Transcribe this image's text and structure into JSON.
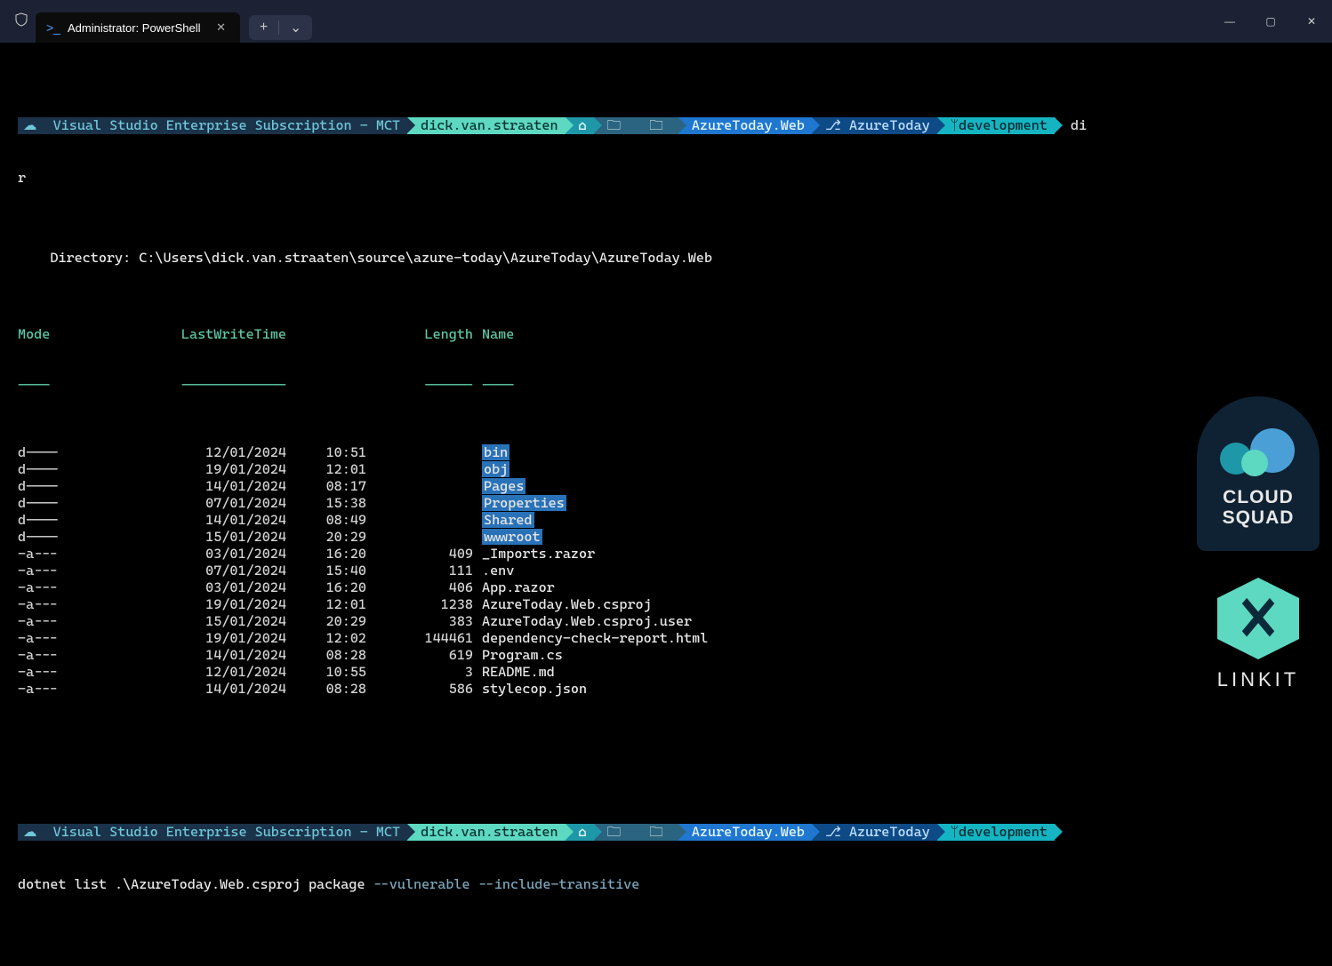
{
  "window": {
    "tab_title": "Administrator: PowerShell"
  },
  "prompt": {
    "subscription": "Visual Studio Enterprise Subscription - MCT",
    "user": "dick.van.straaten",
    "folder": "AzureToday.Web",
    "repo": "AzureToday",
    "branch": "development"
  },
  "session1": {
    "cmd_tail": "di",
    "cmd_wrap": "r",
    "dirline": "    Directory: C:\\Users\\dick.van.straaten\\source\\azure-today\\AzureToday\\AzureToday.Web",
    "headers": {
      "mode": "Mode",
      "lwt": "LastWriteTime",
      "len": "Length",
      "name": "Name"
    },
    "dashes": {
      "mode": "----",
      "lwt": "-------------",
      "len": "------",
      "name": "----"
    },
    "rows": [
      {
        "mode": "d----",
        "date": "12/01/2024",
        "time": "10:51",
        "len": "",
        "name": "bin",
        "dir": true
      },
      {
        "mode": "d----",
        "date": "19/01/2024",
        "time": "12:01",
        "len": "",
        "name": "obj",
        "dir": true
      },
      {
        "mode": "d----",
        "date": "14/01/2024",
        "time": "08:17",
        "len": "",
        "name": "Pages",
        "dir": true
      },
      {
        "mode": "d----",
        "date": "07/01/2024",
        "time": "15:38",
        "len": "",
        "name": "Properties",
        "dir": true
      },
      {
        "mode": "d----",
        "date": "14/01/2024",
        "time": "08:49",
        "len": "",
        "name": "Shared",
        "dir": true
      },
      {
        "mode": "d----",
        "date": "15/01/2024",
        "time": "20:29",
        "len": "",
        "name": "wwwroot",
        "dir": true
      },
      {
        "mode": "-a---",
        "date": "03/01/2024",
        "time": "16:20",
        "len": "409",
        "name": "_Imports.razor",
        "dir": false
      },
      {
        "mode": "-a---",
        "date": "07/01/2024",
        "time": "15:40",
        "len": "111",
        "name": ".env",
        "dir": false
      },
      {
        "mode": "-a---",
        "date": "03/01/2024",
        "time": "16:20",
        "len": "406",
        "name": "App.razor",
        "dir": false
      },
      {
        "mode": "-a---",
        "date": "19/01/2024",
        "time": "12:01",
        "len": "1238",
        "name": "AzureToday.Web.csproj",
        "dir": false
      },
      {
        "mode": "-a---",
        "date": "15/01/2024",
        "time": "20:29",
        "len": "383",
        "name": "AzureToday.Web.csproj.user",
        "dir": false
      },
      {
        "mode": "-a---",
        "date": "19/01/2024",
        "time": "12:02",
        "len": "144461",
        "name": "dependency-check-report.html",
        "dir": false
      },
      {
        "mode": "-a---",
        "date": "14/01/2024",
        "time": "08:28",
        "len": "619",
        "name": "Program.cs",
        "dir": false
      },
      {
        "mode": "-a---",
        "date": "12/01/2024",
        "time": "10:55",
        "len": "3",
        "name": "README.md",
        "dir": false
      },
      {
        "mode": "-a---",
        "date": "14/01/2024",
        "time": "08:28",
        "len": "586",
        "name": "stylecop.json",
        "dir": false
      }
    ]
  },
  "session2": {
    "cmd_main": "dotnet list .\\AzureToday.Web.csproj package ",
    "cmd_opts": "--vulnerable --include-transitive"
  },
  "logos": {
    "cs1": "CLOUD",
    "cs2": "SQUAD",
    "linkit": "LINKIT"
  }
}
